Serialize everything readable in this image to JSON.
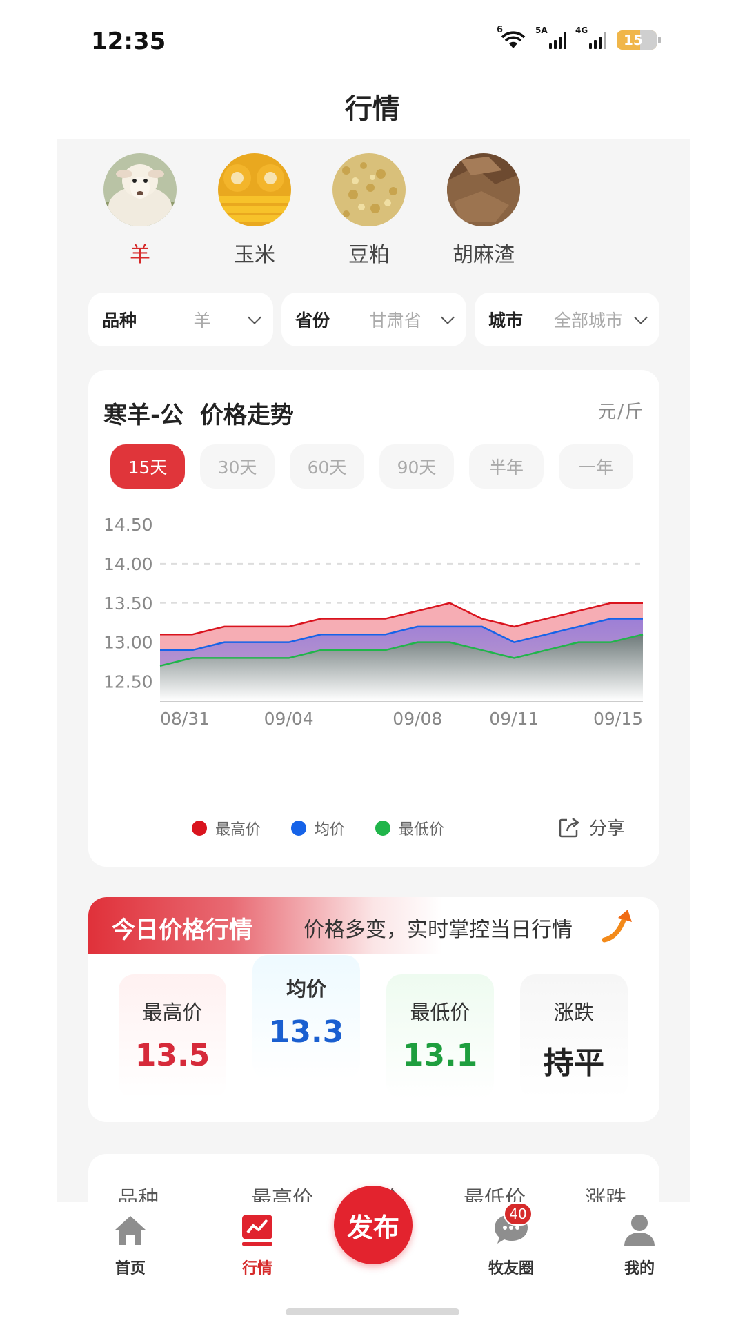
{
  "status": {
    "time": "12:35",
    "wifi_label": "6",
    "sim1": "5A",
    "sim2": "4G",
    "battery": "15"
  },
  "page": {
    "title": "行情"
  },
  "categories": [
    {
      "name": "羊",
      "icon": "sheep-photo",
      "active": true
    },
    {
      "name": "玉米",
      "icon": "corn-photo",
      "active": false
    },
    {
      "name": "豆粕",
      "icon": "soybean-meal-photo",
      "active": false
    },
    {
      "name": "胡麻渣",
      "icon": "flax-cake-photo",
      "active": false
    }
  ],
  "filters": [
    {
      "key": "品种",
      "value": "羊"
    },
    {
      "key": "省份",
      "value": "甘肃省"
    },
    {
      "key": "城市",
      "value": "全部城市"
    }
  ],
  "chart_card": {
    "title": "寒羊-公  价格走势",
    "unit": "元/斤",
    "ranges": [
      "15天",
      "30天",
      "60天",
      "90天",
      "半年",
      "一年"
    ],
    "active_range": "15天",
    "share_label": "分享"
  },
  "chart_data": {
    "type": "area",
    "x": [
      "08/31",
      "09/01",
      "09/02",
      "09/03",
      "09/04",
      "09/05",
      "09/06",
      "09/07",
      "09/08",
      "09/09",
      "09/10",
      "09/11",
      "09/12",
      "09/13",
      "09/14",
      "09/15"
    ],
    "x_tick_labels": [
      "08/31",
      "09/04",
      "09/08",
      "09/11",
      "09/15"
    ],
    "y_tick_labels": [
      "14.50",
      "14.00",
      "13.50",
      "13.00",
      "12.50"
    ],
    "ylim": [
      12.25,
      14.5
    ],
    "grid": true,
    "legend_position": "bottom",
    "series": [
      {
        "name": "最高价",
        "color": "#d9141e",
        "values": [
          13.1,
          13.1,
          13.2,
          13.2,
          13.2,
          13.3,
          13.3,
          13.3,
          13.4,
          13.5,
          13.3,
          13.2,
          13.3,
          13.4,
          13.5,
          13.5
        ]
      },
      {
        "name": "均价",
        "color": "#1663e8",
        "values": [
          12.9,
          12.9,
          13.0,
          13.0,
          13.0,
          13.1,
          13.1,
          13.1,
          13.2,
          13.2,
          13.2,
          13.0,
          13.1,
          13.2,
          13.3,
          13.3
        ]
      },
      {
        "name": "最低价",
        "color": "#20b54a",
        "values": [
          12.7,
          12.8,
          12.8,
          12.8,
          12.8,
          12.9,
          12.9,
          12.9,
          13.0,
          13.0,
          12.9,
          12.8,
          12.9,
          13.0,
          13.0,
          13.1
        ]
      }
    ]
  },
  "today": {
    "title": "今日价格行情",
    "subtitle": "价格多变，实时掌控当日行情",
    "stats": [
      {
        "label": "最高价",
        "value": "13.5",
        "color": "#d62a3a"
      },
      {
        "label": "均价",
        "value": "13.3",
        "color": "#1a5fd0"
      },
      {
        "label": "最低价",
        "value": "13.1",
        "color": "#1e9e3e"
      },
      {
        "label": "涨跌",
        "value": "持平",
        "color": "#222222"
      }
    ]
  },
  "table": {
    "headers": [
      "品种",
      "最高价",
      "均价",
      "最低价",
      "涨跌"
    ]
  },
  "tabbar": {
    "items": [
      {
        "label": "首页",
        "icon": "home-icon"
      },
      {
        "label": "行情",
        "icon": "market-chart-icon",
        "active": true
      },
      {
        "label": "发布",
        "icon": "publish-button"
      },
      {
        "label": "牧友圈",
        "icon": "chat-bubble-icon",
        "badge": "40"
      },
      {
        "label": "我的",
        "icon": "person-icon"
      }
    ]
  }
}
